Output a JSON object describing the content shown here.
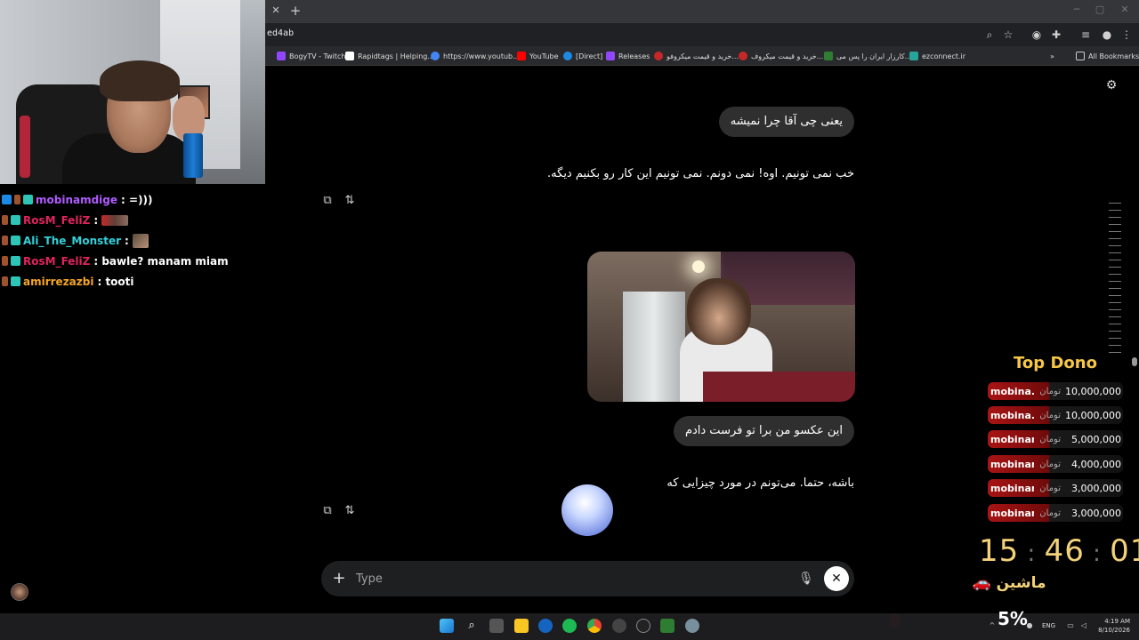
{
  "browser": {
    "url_fragment": "ed4ab",
    "bookmarks": [
      {
        "label": "BogyTV - Twitch",
        "color": "#9146ff"
      },
      {
        "label": "Rapidtags | Helping...",
        "color": "#ffffff"
      },
      {
        "label": "https://www.youtub...",
        "color": "#4285f4"
      },
      {
        "label": "YouTube",
        "color": "#ff0000"
      },
      {
        "label": "[Direct]",
        "color": "#1e88e5"
      },
      {
        "label": "Releases",
        "color": "#9146ff"
      },
      {
        "label": "خرید و قیمت میکروفو...",
        "color": "#c62828"
      },
      {
        "label": "خرید و قیمت میکروف...",
        "color": "#c62828"
      },
      {
        "label": "کارزار ایران را پس می...",
        "color": "#2e7d32"
      },
      {
        "label": "ezconnect.ir",
        "color": "#26a69a"
      }
    ],
    "all_bookmarks_label": "All Bookmarks"
  },
  "chat": [
    {
      "user": "mobinamdige",
      "color": "#b05cff",
      "message": ": =)))"
    },
    {
      "user": "RosM_FeliZ",
      "color": "#e0245e",
      "message": ":"
    },
    {
      "user": "Ali_The_Monster",
      "color": "#35d0d9",
      "message": ":"
    },
    {
      "user": "RosM_FeliZ",
      "color": "#e0245e",
      "message": ": bawle? manam miam"
    },
    {
      "user": "amirrezazbi",
      "color": "#f5a623",
      "message": ": tooti"
    }
  ],
  "conversation": {
    "user_message_1": "یعنی چی آقا چرا نمیشه",
    "ai_message_1": "خب نمی تونیم. اوه! نمی دونم. نمی تونیم این کار رو بکنیم دیگه.",
    "user_message_2": "این عکسو من برا تو فرست دادم",
    "ai_message_2": "باشه، حتما. می‌تونم در مورد چیزایی که"
  },
  "input": {
    "placeholder": "Type"
  },
  "dono": {
    "title": "Top Dono",
    "currency": "تومان",
    "rows": [
      {
        "name": "mobina...",
        "amount": "10,000,000"
      },
      {
        "name": "mobina...",
        "amount": "10,000,000"
      },
      {
        "name": "mobinam...",
        "amount": "5,000,000"
      },
      {
        "name": "mobinam...",
        "amount": "4,000,000"
      },
      {
        "name": "mobinam...",
        "amount": "3,000,000"
      },
      {
        "name": "mobinam...",
        "amount": "3,000,000"
      }
    ]
  },
  "timer": {
    "h": "15",
    "m": "46",
    "s": "01"
  },
  "goal": {
    "label": "ماشین",
    "icon": "car-icon",
    "percent": "5%"
  },
  "taskbar": {
    "lang": "ENG",
    "time": "4:19 AM",
    "date": "8/10/2026"
  }
}
